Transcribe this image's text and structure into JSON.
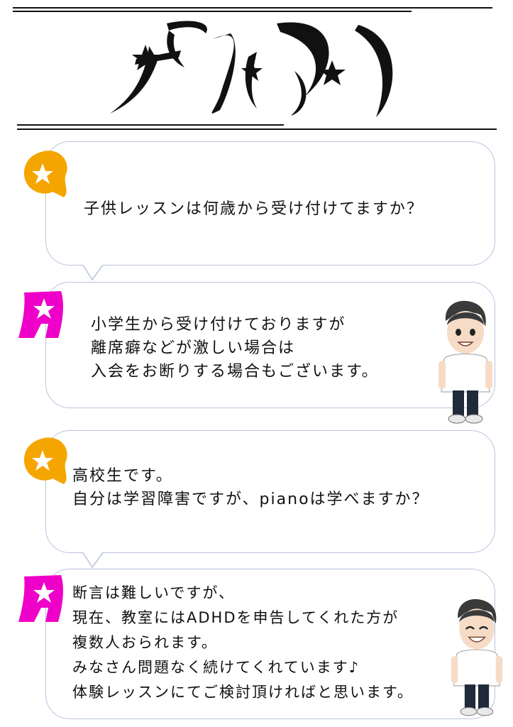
{
  "title": {
    "art_text": "FAQ"
  },
  "faq": [
    {
      "kind": "question",
      "badge_color": "#F5A500",
      "lines": [
        "子供レッスンは何歳から受け付けてますか？"
      ]
    },
    {
      "kind": "answer",
      "badge_color": "#EE00C8",
      "lines": [
        "小学生から受け付けておりますが",
        "離席癖などが激しい場合は",
        "入会をお断りする場合もございます。"
      ]
    },
    {
      "kind": "question",
      "badge_color": "#F5A500",
      "lines": [
        "高校生です。",
        "自分は学習障害ですが、pianoは学べますか？"
      ]
    },
    {
      "kind": "answer",
      "badge_color": "#EE00C8",
      "lines": [
        "断言は難しいですが、",
        "現在、教室にはADHDを申告してくれた方が",
        "複数人おられます。",
        "みなさん問題なく続けてくれています♪",
        "体験レッスンにてご検討頂ければと思います。"
      ]
    }
  ],
  "colors": {
    "question_badge": "#F5A500",
    "answer_badge": "#EE00C8",
    "bubble_border": "#B9C3DD"
  },
  "icons": [
    "star-icon",
    "teacher-avatar-icon"
  ]
}
